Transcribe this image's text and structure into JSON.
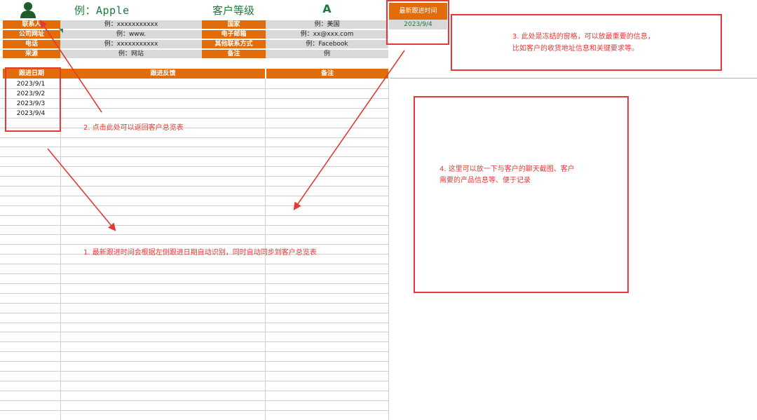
{
  "header": {
    "customer_name": "例：Apple",
    "level_label": "客户等级",
    "level_value": "A"
  },
  "info_rows": [
    {
      "l1": "联系人",
      "v1": "例：xxxxxxxxxxx",
      "l2": "国家",
      "v2": "例：美国"
    },
    {
      "l1": "公司网址",
      "v1": "例：www.",
      "l2": "电子邮箱",
      "v2": "例：xx@xxx.com"
    },
    {
      "l1": "电话",
      "v1": "例：xxxxxxxxxxx",
      "l2": "其他联系方式",
      "v2": "例：Facebook"
    },
    {
      "l1": "来源",
      "v1": "例：网站",
      "l2": "备注",
      "v2": "例"
    }
  ],
  "latest": {
    "label": "最新跟进时间",
    "value": "2023/9/4"
  },
  "table": {
    "headers": [
      "跟进日期",
      "跟进反馈",
      "备注"
    ],
    "dates": [
      "2023/9/1",
      "2023/9/2",
      "2023/9/3",
      "2023/9/4"
    ]
  },
  "annotations": {
    "note1": "1. 最新跟进时间会根据左侧跟进日期自动识别，同时自动同步到客户总览表",
    "note2": "2. 点击此处可以返回客户总览表",
    "note3_line1": "3. 此处是冻结的窗格，可以放最重要的信息，",
    "note3_line2": "比如客户的收货地址信息和关键要求等。",
    "note4_line1": "4. 这里可以放一下与客户的聊天截图、客户",
    "note4_line2": "需要的产品信息等、便于记录"
  },
  "colors": {
    "header_orange": "#e36c0a",
    "value_gray": "#d9d9d9",
    "accent_green": "#1e7a3c",
    "annotation_red": "#e53935"
  }
}
